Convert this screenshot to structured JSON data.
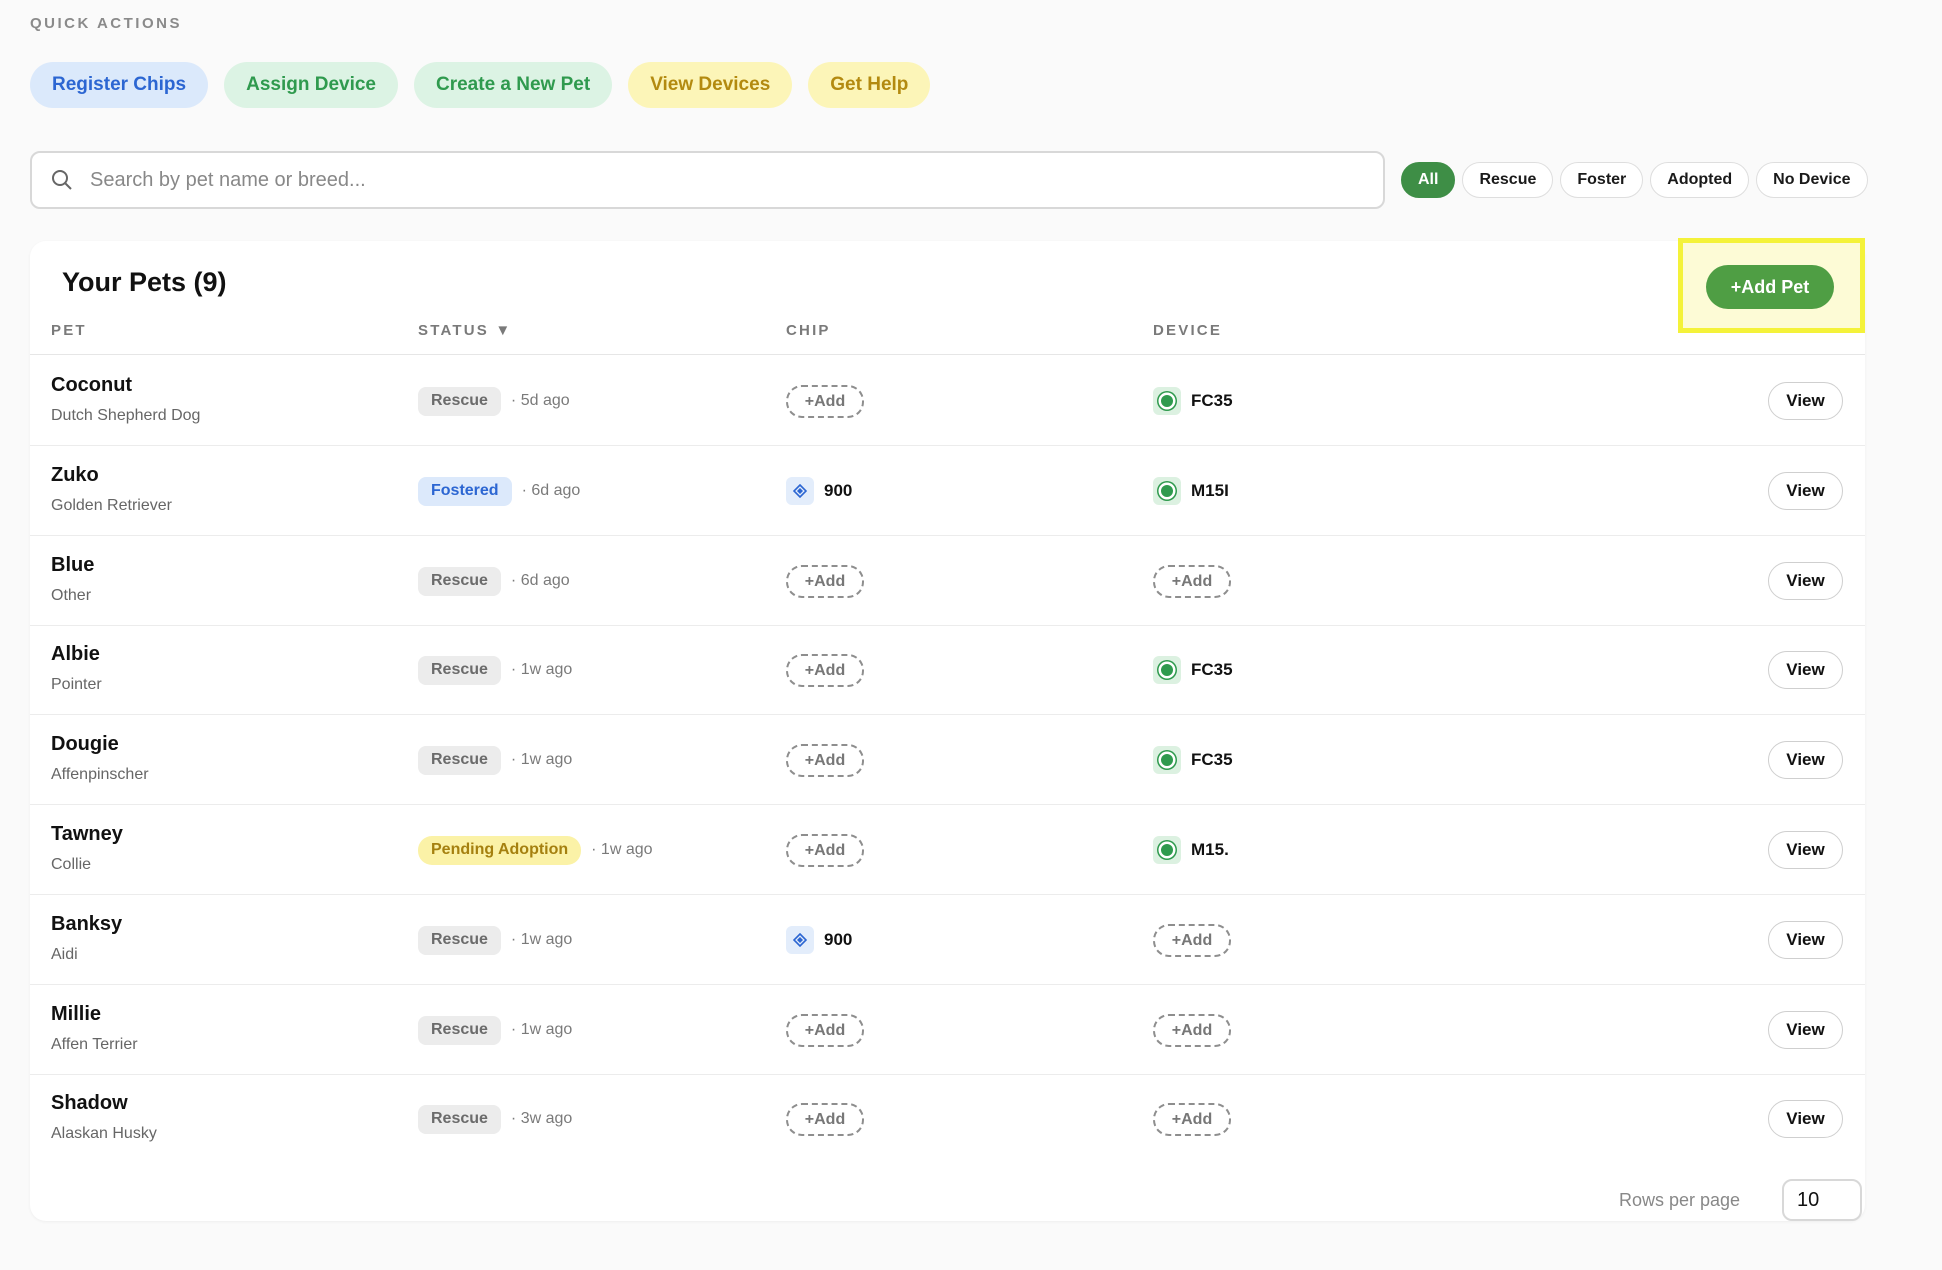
{
  "quick_actions": {
    "title": "QUICK ACTIONS",
    "buttons": [
      {
        "label": "Register Chips"
      },
      {
        "label": "Assign Device"
      },
      {
        "label": "Create a New Pet"
      },
      {
        "label": "View Devices"
      },
      {
        "label": "Get Help"
      }
    ]
  },
  "search": {
    "placeholder": "Search by pet name or breed..."
  },
  "filters": [
    {
      "label": "All",
      "active": true
    },
    {
      "label": "Rescue"
    },
    {
      "label": "Foster"
    },
    {
      "label": "Adopted"
    },
    {
      "label": "No Device"
    }
  ],
  "pets_card": {
    "title": "Your Pets (9)",
    "add_button": "+Add Pet",
    "columns": {
      "pet": "PET",
      "status": "STATUS ▼",
      "chip": "CHIP",
      "device": "DEVICE"
    },
    "add_label": "+Add",
    "view_label": "View",
    "rows": [
      {
        "name": "Coconut",
        "breed": "Dutch Shepherd Dog",
        "status": "Rescue",
        "status_type": "rescue",
        "ago": "· 5d ago",
        "chip": null,
        "device": "FC35"
      },
      {
        "name": "Zuko",
        "breed": "Golden Retriever",
        "status": "Fostered",
        "status_type": "fostered",
        "ago": "· 6d ago",
        "chip": "900",
        "device": "M15I"
      },
      {
        "name": "Blue",
        "breed": "Other",
        "status": "Rescue",
        "status_type": "rescue",
        "ago": "· 6d ago",
        "chip": null,
        "device": null
      },
      {
        "name": "Albie",
        "breed": "Pointer",
        "status": "Rescue",
        "status_type": "rescue",
        "ago": "· 1w ago",
        "chip": null,
        "device": "FC35"
      },
      {
        "name": "Dougie",
        "breed": "Affenpinscher",
        "status": "Rescue",
        "status_type": "rescue",
        "ago": "· 1w ago",
        "chip": null,
        "device": "FC35"
      },
      {
        "name": "Tawney",
        "breed": "Collie",
        "status": "Pending Adoption",
        "status_type": "pending",
        "ago": "· 1w ago",
        "chip": null,
        "device": "M15."
      },
      {
        "name": "Banksy",
        "breed": "Aidi",
        "status": "Rescue",
        "status_type": "rescue",
        "ago": "· 1w ago",
        "chip": "900",
        "device": null
      },
      {
        "name": "Millie",
        "breed": "Affen Terrier",
        "status": "Rescue",
        "status_type": "rescue",
        "ago": "· 1w ago",
        "chip": null,
        "device": null
      },
      {
        "name": "Shadow",
        "breed": "Alaskan Husky",
        "status": "Rescue",
        "status_type": "rescue",
        "ago": "· 3w ago",
        "chip": null,
        "device": null
      }
    ],
    "pagination": {
      "rows_per_page_label": "Rows per page",
      "rows_per_page_value": "10"
    }
  }
}
